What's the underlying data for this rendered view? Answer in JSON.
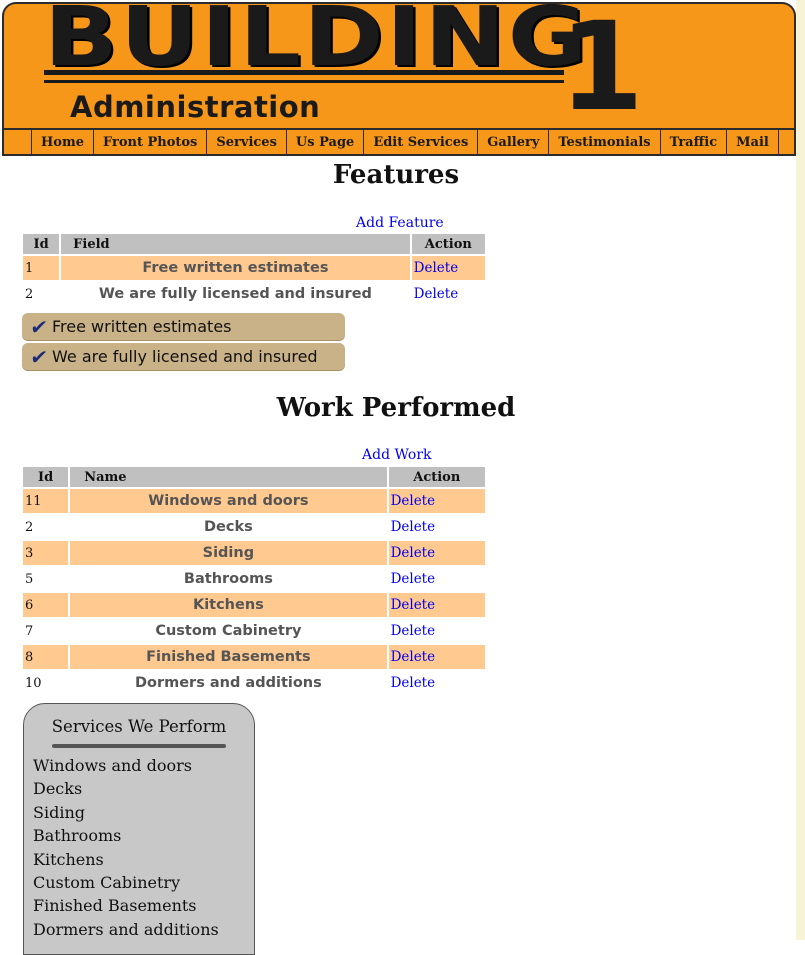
{
  "header": {
    "logo_word": "BUILDING",
    "logo_number": "1",
    "subtitle": "Administration"
  },
  "nav": {
    "items": [
      "Home",
      "Front Photos",
      "Services",
      "Us Page",
      "Edit Services",
      "Gallery",
      "Testimonials",
      "Traffic",
      "Mail"
    ]
  },
  "features": {
    "heading": "Features",
    "add_link": "Add Feature",
    "columns": [
      "Id",
      "Field",
      "Action"
    ],
    "rows": [
      {
        "id": "1",
        "field": "Free written estimates",
        "action": "Delete"
      },
      {
        "id": "2",
        "field": "We are fully licensed and insured",
        "action": "Delete"
      }
    ],
    "preview": [
      "Free written estimates",
      "We are fully licensed and insured"
    ],
    "check_icon": "✔"
  },
  "work": {
    "heading": "Work Performed",
    "add_link": "Add Work",
    "columns": [
      "Id",
      "Name",
      "Action"
    ],
    "rows": [
      {
        "id": "11",
        "name": "Windows and doors",
        "action": "Delete"
      },
      {
        "id": "2",
        "name": "Decks",
        "action": "Delete"
      },
      {
        "id": "3",
        "name": "Siding",
        "action": "Delete"
      },
      {
        "id": "5",
        "name": "Bathrooms",
        "action": "Delete"
      },
      {
        "id": "6",
        "name": "Kitchens",
        "action": "Delete"
      },
      {
        "id": "7",
        "name": "Custom Cabinetry",
        "action": "Delete"
      },
      {
        "id": "8",
        "name": "Finished Basements",
        "action": "Delete"
      },
      {
        "id": "10",
        "name": "Dormers and additions",
        "action": "Delete"
      }
    ]
  },
  "services_box": {
    "title": "Services We Perform",
    "items": [
      "Windows and doors",
      "Decks",
      "Siding",
      "Bathrooms",
      "Kitchens",
      "Custom Cabinetry",
      "Finished Basements",
      "Dormers and additions"
    ]
  },
  "colors": {
    "header_orange": "#f7971a",
    "row_highlight": "#ffc990",
    "table_header": "#c0c0c0",
    "pill": "#c9b287",
    "link": "#0000ee"
  }
}
